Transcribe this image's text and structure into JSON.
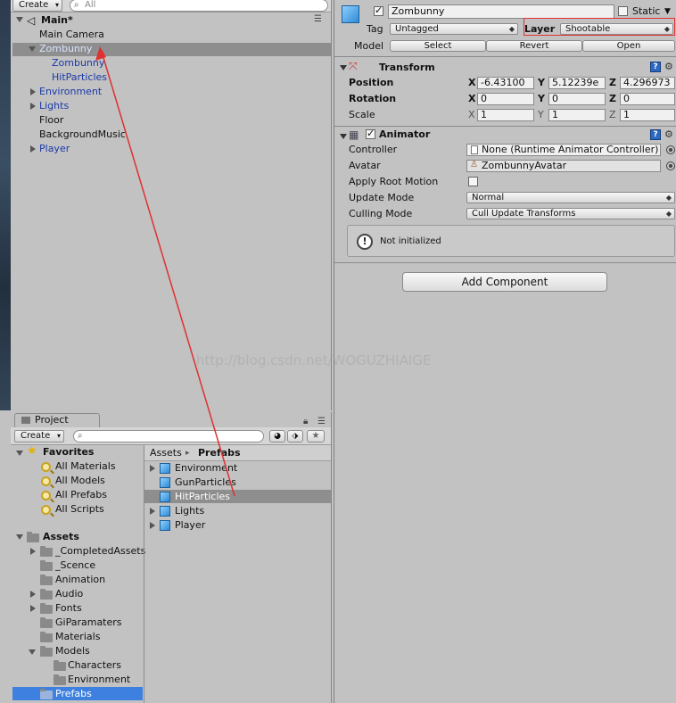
{
  "hierarchy": {
    "create_label": "Create",
    "search_placeholder": "All",
    "scene_name": "Main*",
    "items": [
      {
        "label": "Main Camera"
      },
      {
        "label": "Zombunny"
      },
      {
        "label": "Zombunny"
      },
      {
        "label": "HitParticles"
      },
      {
        "label": "Environment"
      },
      {
        "label": "Lights"
      },
      {
        "label": "Floor"
      },
      {
        "label": "BackgroundMusic"
      },
      {
        "label": "Player"
      }
    ]
  },
  "project": {
    "tab_label": "Project",
    "create_label": "Create",
    "favorites": {
      "label": "Favorites",
      "items": [
        "All Materials",
        "All Models",
        "All Prefabs",
        "All Scripts"
      ]
    },
    "assets": {
      "label": "Assets",
      "items": [
        "_CompletedAssets",
        "_Scence",
        "Animation",
        "Audio",
        "Fonts",
        "GiParamaters",
        "Materials",
        "Models",
        "Characters",
        "Environment",
        "Prefabs"
      ]
    },
    "breadcrumb": {
      "root": "Assets",
      "sep": "▸",
      "current": "Prefabs"
    },
    "prefabs": [
      "Environment",
      "GunParticles",
      "HitParticles",
      "Lights",
      "Player"
    ]
  },
  "inspector": {
    "object_name": "Zombunny",
    "static_label": "Static",
    "tag_label": "Tag",
    "tag_value": "Untagged",
    "layer_label": "Layer",
    "layer_value": "Shootable",
    "model_label": "Model",
    "model_buttons": [
      "Select",
      "Revert",
      "Open"
    ],
    "transform": {
      "title": "Transform",
      "position_label": "Position",
      "rotation_label": "Rotation",
      "scale_label": "Scale",
      "position": {
        "x": "-6.43100",
        "y": "5.12239e",
        "z": "4.296973"
      },
      "rotation": {
        "x": "0",
        "y": "0",
        "z": "0"
      },
      "scale": {
        "x": "1",
        "y": "1",
        "z": "1"
      },
      "axes": [
        "X",
        "Y",
        "Z"
      ]
    },
    "animator": {
      "title": "Animator",
      "controller_label": "Controller",
      "controller_value": "None (Runtime Animator Controller)",
      "avatar_label": "Avatar",
      "avatar_value": "ZombunnyAvatar",
      "apply_root_motion_label": "Apply Root Motion",
      "update_mode_label": "Update Mode",
      "update_mode_value": "Normal",
      "culling_mode_label": "Culling Mode",
      "culling_mode_value": "Cull Update Transforms",
      "notice": "Not initialized"
    },
    "add_component_label": "Add Component"
  },
  "watermark": "http://blog.csdn.net/WOGUZHIAIGE",
  "colors": {
    "selection_gray": "#8e8e8e",
    "selection_blue": "#3d80df",
    "annotation_red": "#e03030",
    "link_blue": "#1a3aa8"
  }
}
